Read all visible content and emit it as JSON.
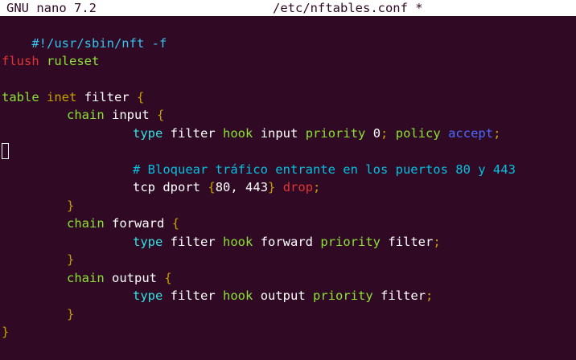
{
  "titlebar": {
    "app": "GNU nano 7.2",
    "file": "/etc/nftables.conf *"
  },
  "code": {
    "shebang": "#!/usr/sbin/nft -f",
    "flush": "flush",
    "ruleset": "ruleset",
    "table": "table",
    "inet": "inet",
    "filter_name": "filter",
    "brace_open": "{",
    "brace_close": "}",
    "chain": "chain",
    "input": "input",
    "forward": "forward",
    "output": "output",
    "type": "type",
    "filter": "filter",
    "hook": "hook",
    "priority": "priority",
    "zero": "0",
    "semicolon": ";",
    "policy": "policy",
    "accept": "accept",
    "comment": "# Bloquear tráfico entrante en los puertos 80 y 443",
    "tcp": "tcp",
    "dport": "dport",
    "ports": "80, 443",
    "drop": "drop"
  }
}
